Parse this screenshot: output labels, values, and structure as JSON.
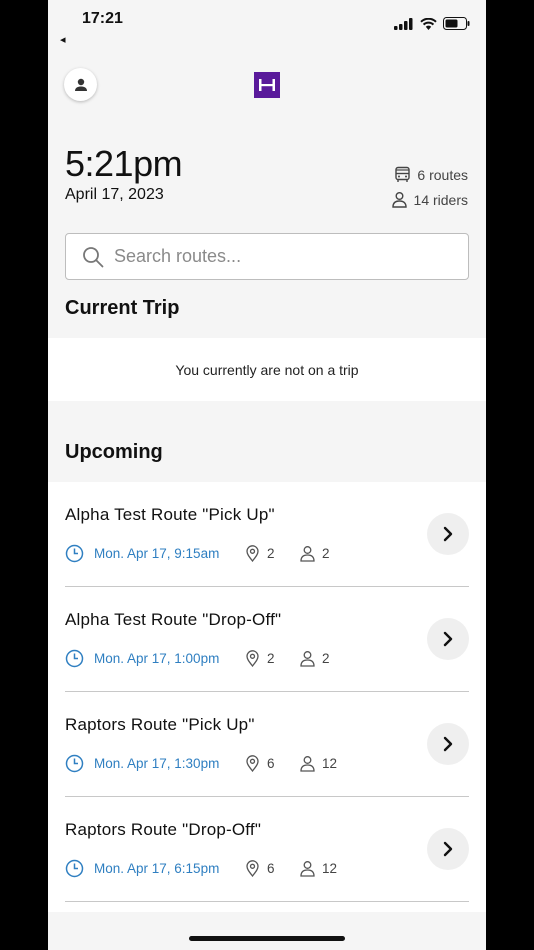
{
  "status_bar": {
    "time": "17:21",
    "back_indicator": "◂"
  },
  "header": {
    "avatar_icon": "person-icon",
    "logo_text": "H"
  },
  "summary": {
    "time": "5:21pm",
    "date": "April 17, 2023",
    "routes_count": "6 routes",
    "riders_count": "14 riders"
  },
  "search": {
    "placeholder": "Search routes..."
  },
  "current_trip": {
    "title": "Current Trip",
    "message": "You currently are not on a trip"
  },
  "upcoming": {
    "title": "Upcoming",
    "routes": [
      {
        "name": "Alpha Test Route \"Pick Up\"",
        "time": "Mon. Apr 17, 9:15am",
        "stops": "2",
        "riders": "2"
      },
      {
        "name": "Alpha Test Route \"Drop-Off\"",
        "time": "Mon. Apr 17, 1:00pm",
        "stops": "2",
        "riders": "2"
      },
      {
        "name": "Raptors Route \"Pick Up\"",
        "time": "Mon. Apr 17, 1:30pm",
        "stops": "6",
        "riders": "12"
      },
      {
        "name": "Raptors Route \"Drop-Off\"",
        "time": "Mon. Apr 17, 6:15pm",
        "stops": "6",
        "riders": "12"
      }
    ]
  },
  "colors": {
    "accent": "#2f7fc1",
    "brand": "#5a1a9b"
  }
}
